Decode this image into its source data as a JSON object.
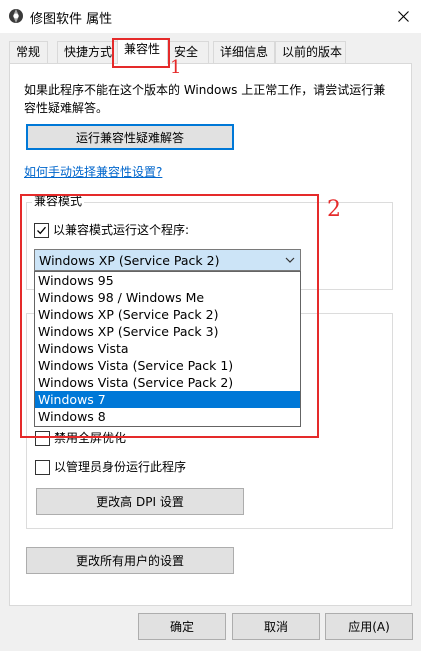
{
  "window": {
    "title": "修图软件 属性"
  },
  "tabs": [
    {
      "label": "常规"
    },
    {
      "label": "快捷方式"
    },
    {
      "label": "兼容性"
    },
    {
      "label": "安全"
    },
    {
      "label": "详细信息"
    },
    {
      "label": "以前的版本"
    }
  ],
  "intro": {
    "line1": "如果此程序不能在这个版本的 Windows 上正常工作，请尝试运行兼",
    "line2": "容性疑难解答。"
  },
  "troubleshoot_button": "运行兼容性疑难解答",
  "manual_link": "如何手动选择兼容性设置?",
  "compat_mode": {
    "group_label": "兼容模式",
    "checkbox_label": "以兼容模式运行这个程序:",
    "checked": true,
    "selected": "Windows XP (Service Pack 2)",
    "options": [
      "Windows 95",
      "Windows 98 / Windows Me",
      "Windows XP (Service Pack 2)",
      "Windows XP (Service Pack 3)",
      "Windows Vista",
      "Windows Vista (Service Pack 1)",
      "Windows Vista (Service Pack 2)",
      "Windows 7",
      "Windows 8"
    ],
    "highlighted": "Windows 7"
  },
  "settings": {
    "fullscreen_label": "禁用全屏优化",
    "admin_label": "以管理员身份运行此程序",
    "dpi_button": "更改高 DPI 设置"
  },
  "all_users_button": "更改所有用户的设置",
  "footer": {
    "ok": "确定",
    "cancel": "取消",
    "apply": "应用(A)"
  },
  "annotations": {
    "one": "1",
    "two": "2"
  },
  "colors": {
    "accent": "#0078d7",
    "annotation_red": "#e52a2a",
    "link": "#0066cc"
  }
}
